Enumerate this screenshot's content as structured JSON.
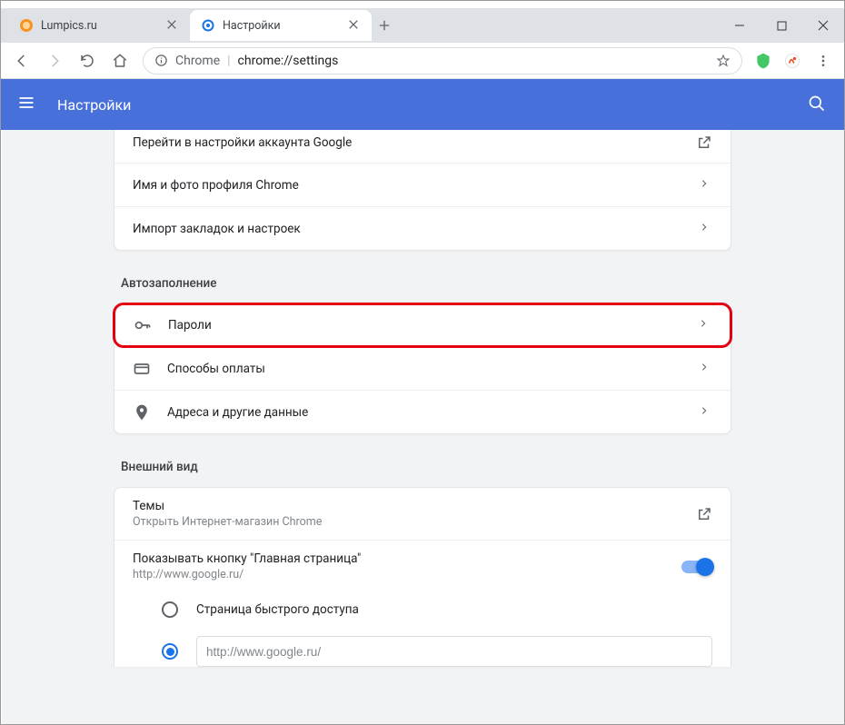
{
  "tabs": [
    {
      "title": "Lumpics.ru",
      "active": false
    },
    {
      "title": "Настройки",
      "active": true
    }
  ],
  "addressbar": {
    "scheme_label": "Chrome",
    "url_text": "chrome://settings"
  },
  "header": {
    "title": "Настройки"
  },
  "sections": {
    "account_rows": [
      {
        "label": "Перейти в настройки аккаунта Google",
        "ext": true
      },
      {
        "label": "Имя и фото профиля Chrome",
        "ext": false
      },
      {
        "label": "Импорт закладок и настроек",
        "ext": false
      }
    ],
    "autofill": {
      "title": "Автозаполнение",
      "rows": [
        {
          "icon": "key",
          "label": "Пароли"
        },
        {
          "icon": "card",
          "label": "Способы оплаты"
        },
        {
          "icon": "pin",
          "label": "Адреса и другие данные"
        }
      ]
    },
    "appearance": {
      "title": "Внешний вид",
      "themes_label": "Темы",
      "themes_sub": "Открыть Интернет-магазин Chrome",
      "homebutton_label": "Показывать кнопку \"Главная страница\"",
      "homebutton_sub": "http://www.google.ru/",
      "radio_quick": "Страница быстрого доступа",
      "radio_url_value": "http://www.google.ru/"
    }
  }
}
